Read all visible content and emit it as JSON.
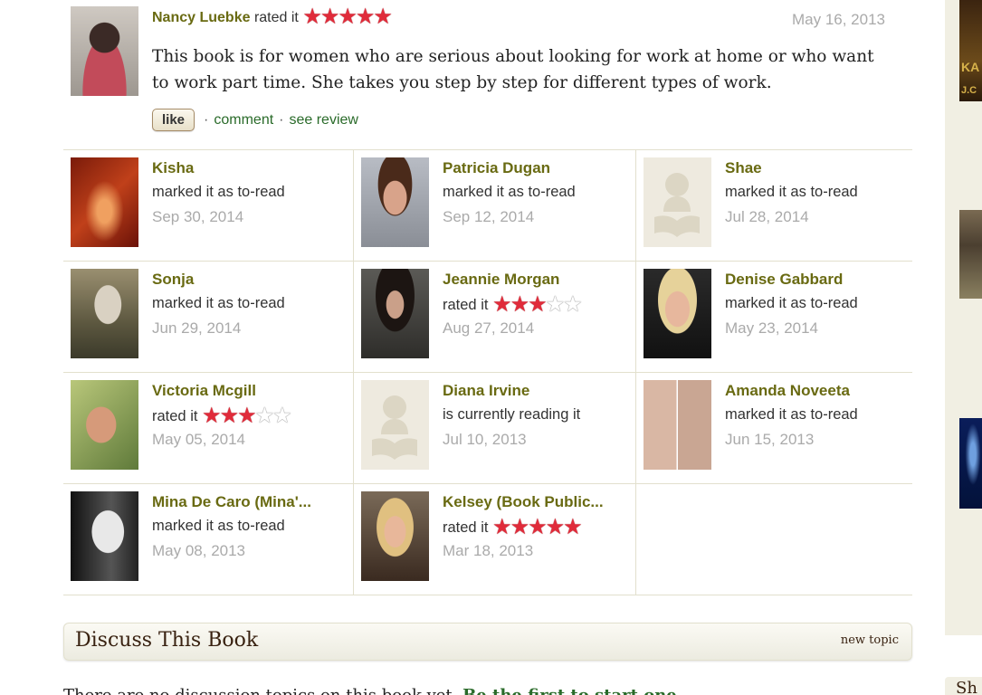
{
  "review": {
    "user": "Nancy Luebke",
    "action": "rated it",
    "rating": 5,
    "date": "May 16, 2013",
    "text": "This book is for women who are serious about looking for work at home or who want to work part time. She takes you step by step for different types of work.",
    "like_label": "like",
    "comment_label": "comment",
    "see_review_label": "see review",
    "separator": "·"
  },
  "activity": [
    {
      "name": "Kisha",
      "action": "marked it as to-read",
      "date": "Sep 30, 2014",
      "avatar": "av-kisha",
      "rating": null
    },
    {
      "name": "Patricia Dugan",
      "action": "marked it as to-read",
      "date": "Sep 12, 2014",
      "avatar": "av-patricia",
      "rating": null
    },
    {
      "name": "Shae",
      "action": "marked it as to-read",
      "date": "Jul 28, 2014",
      "avatar": "placeholder",
      "rating": null
    },
    {
      "name": "Sonja",
      "action": "marked it as to-read",
      "date": "Jun 29, 2014",
      "avatar": "av-sonja",
      "rating": null
    },
    {
      "name": "Jeannie Morgan",
      "action": "rated it",
      "date": "Aug 27, 2014",
      "avatar": "av-jeannie",
      "rating": 3
    },
    {
      "name": "Denise Gabbard",
      "action": "marked it as to-read",
      "date": "May 23, 2014",
      "avatar": "av-denise",
      "rating": null
    },
    {
      "name": "Victoria Mcgill",
      "action": "rated it",
      "date": "May 05, 2014",
      "avatar": "av-victoria",
      "rating": 3
    },
    {
      "name": "Diana Irvine",
      "action": "is currently reading it",
      "date": "Jul 10, 2013",
      "avatar": "placeholder",
      "rating": null
    },
    {
      "name": "Amanda Noveeta",
      "action": "marked it as to-read",
      "date": "Jun 15, 2013",
      "avatar": "av-amanda",
      "rating": null
    },
    {
      "name": "Mina De Caro (Mina'...",
      "action": "marked it as to-read",
      "date": "May 08, 2013",
      "avatar": "av-mina",
      "rating": null
    },
    {
      "name": "Kelsey (Book Public...",
      "action": "rated it",
      "date": "Mar 18, 2013",
      "avatar": "av-kelsey",
      "rating": 5
    }
  ],
  "discuss": {
    "title": "Discuss This Book",
    "new_topic_label": "new topic",
    "cut_text_before": "There are no discussion topics on this book yet.",
    "cut_text_link": "Be the first to start one"
  },
  "sidebar": {
    "book1_text": "KA",
    "book1_text2": "J.C",
    "bottom_heading": "Sh"
  },
  "colors": {
    "username": "#696a12",
    "star_on": "#e02b3a",
    "date": "#aaaaaa",
    "link": "#2a6b2a",
    "divider": "#e2e0cd"
  }
}
